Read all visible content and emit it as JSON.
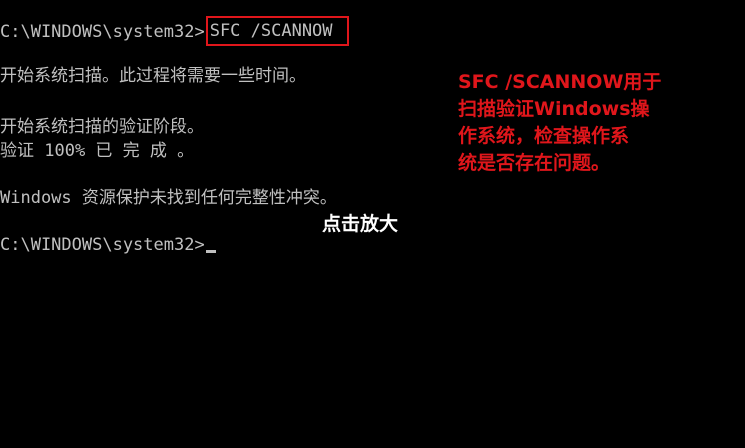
{
  "console": {
    "prompt_1": "C:\\WINDOWS\\system32>",
    "command": "SFC /SCANNOW",
    "line_start_scan": "开始系统扫描。此过程将需要一些时间。",
    "line_start_verify": "开始系统扫描的验证阶段。",
    "line_verify_progress": "验证 100% 已 完 成 。",
    "line_result": "Windows 资源保护未找到任何完整性冲突。",
    "prompt_2": "C:\\WINDOWS\\system32>"
  },
  "annotation": {
    "text": "SFC /SCANNOW用于\n扫描验证Windows操\n作系统，检查操作系\n统是否存在问题。"
  },
  "overlay": {
    "zoom_hint": "点击放大"
  },
  "colors": {
    "background": "#000000",
    "console_text": "#c0c0c0",
    "annotation_red": "#e0161b",
    "hint_white": "#ffffff"
  }
}
